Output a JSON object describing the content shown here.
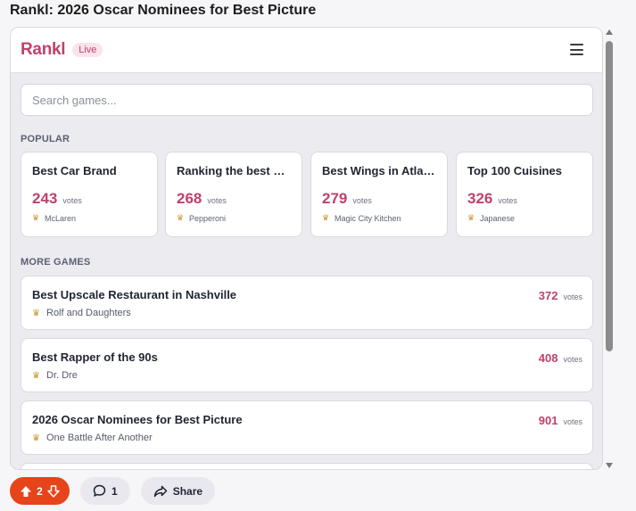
{
  "page_title": "Rankl: 2026 Oscar Nominees for Best Picture",
  "header": {
    "logo": "Rankl",
    "badge": "Live",
    "menu_icon": "hamburger-icon"
  },
  "search": {
    "placeholder": "Search games..."
  },
  "popular": {
    "label": "POPULAR",
    "cards": [
      {
        "title": "Best Car Brand",
        "votes": "243",
        "votes_word": "votes",
        "leader": "McLaren"
      },
      {
        "title": "Ranking the best Pizza Toppings",
        "votes": "268",
        "votes_word": "votes",
        "leader": "Pepperoni"
      },
      {
        "title": "Best Wings in Atlanta",
        "votes": "279",
        "votes_word": "votes",
        "leader": "Magic City Kitchen"
      },
      {
        "title": "Top 100 Cuisines",
        "votes": "326",
        "votes_word": "votes",
        "leader": "Japanese"
      }
    ]
  },
  "more_games": {
    "label": "MORE GAMES",
    "rows": [
      {
        "title": "Best Upscale Restaurant in Nashville",
        "leader": "Rolf and Daughters",
        "votes": "372",
        "votes_word": "votes"
      },
      {
        "title": "Best Rapper of the 90s",
        "leader": "Dr. Dre",
        "votes": "408",
        "votes_word": "votes"
      },
      {
        "title": "2026 Oscar Nominees for Best Picture",
        "leader": "One Battle After Another",
        "votes": "901",
        "votes_word": "votes"
      }
    ]
  },
  "bottom": {
    "vote_count": "2",
    "comment_count": "1",
    "share_label": "Share"
  },
  "colors": {
    "accent": "#c0406c",
    "vote_pill": "#e6441a",
    "trophy": "#c8962e"
  }
}
